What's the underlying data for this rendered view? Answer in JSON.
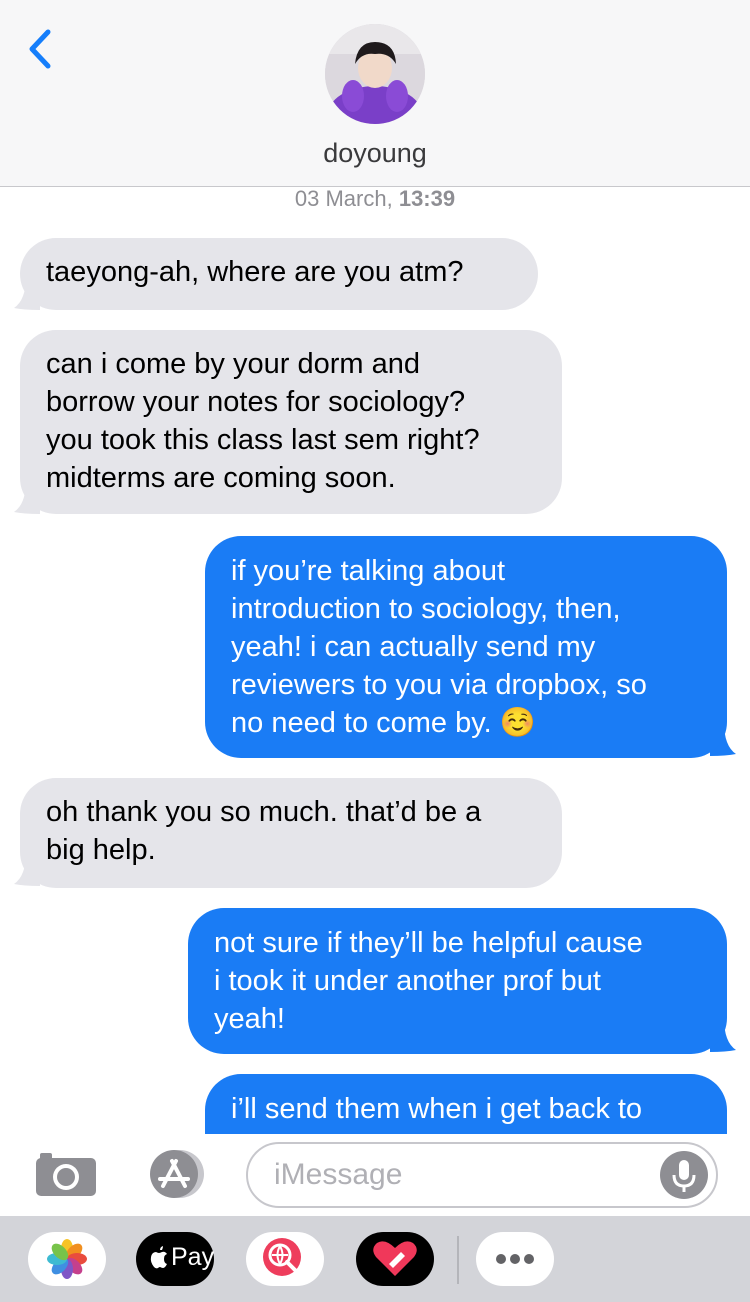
{
  "header": {
    "contact_name": "doyoung",
    "timestamp_date": "03 March,",
    "timestamp_time": "13:39"
  },
  "messages": [
    {
      "side": "incoming",
      "lines": [
        "taeyong-ah, where are you atm?"
      ]
    },
    {
      "side": "incoming",
      "lines": [
        "can i come by your dorm and",
        "borrow your notes for sociology?",
        "you took this class last sem right?",
        "midterms are coming soon."
      ]
    },
    {
      "side": "outgoing",
      "lines": [
        "if you’re talking about",
        "introduction to sociology, then,",
        "yeah! i can actually send my",
        "reviewers to you via dropbox, so",
        "no need to come by. ☺️"
      ]
    },
    {
      "side": "incoming",
      "lines": [
        "oh thank you so much. that’d be a",
        "big help."
      ]
    },
    {
      "side": "outgoing",
      "lines": [
        "not sure if they’ll be helpful cause",
        "i took it under another prof but",
        "yeah!"
      ]
    },
    {
      "side": "outgoing",
      "lines": [
        "i’ll send them when i get back to"
      ]
    }
  ],
  "input": {
    "placeholder": "iMessage"
  },
  "app_drawer": {
    "apple_pay_label": "Pay"
  },
  "colors": {
    "outgoing_bubble": "#1a7cf5",
    "incoming_bubble": "#e5e5ea",
    "accent": "#157efb"
  },
  "icons": [
    "back-chevron-icon",
    "camera-icon",
    "app-store-icon",
    "microphone-icon",
    "photos-app-icon",
    "apple-pay-icon",
    "search-images-icon",
    "digital-touch-icon",
    "more-apps-icon"
  ]
}
